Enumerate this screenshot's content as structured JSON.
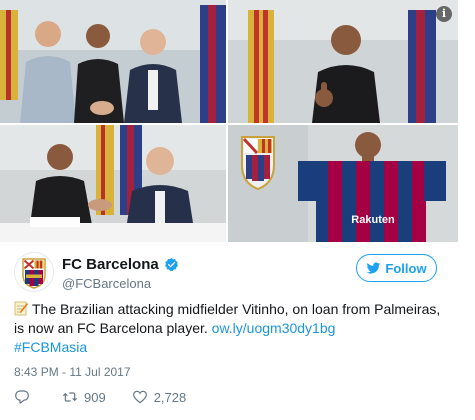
{
  "tweet": {
    "display_name": "FC Barcelona",
    "handle": "@FCBarcelona",
    "follow_label": "Follow",
    "text_before_link": "The Brazilian attacking midfielder Vitinho, on loan from Palmeiras, is now an FC Barcelona player.",
    "link_text": "ow.ly/uogm30dy1bg",
    "hashtag": "#FCBMasia",
    "timestamp": "8:43 PM - 11 Jul 2017",
    "retweet_count": "909",
    "like_count": "2,728",
    "photo_caption": "Rakuten",
    "info_badge": "i"
  },
  "icons": {
    "memo": "memo-icon",
    "verified": "verified-badge-icon",
    "follow": "twitter-bird-icon",
    "reply": "reply-icon",
    "retweet": "retweet-icon",
    "like": "like-heart-icon"
  },
  "colors": {
    "accent": "#1da1f2",
    "link": "#1b95e0",
    "secondary_text": "#657786",
    "barca_blue": "#1a3d7c",
    "barca_red": "#a50044"
  }
}
